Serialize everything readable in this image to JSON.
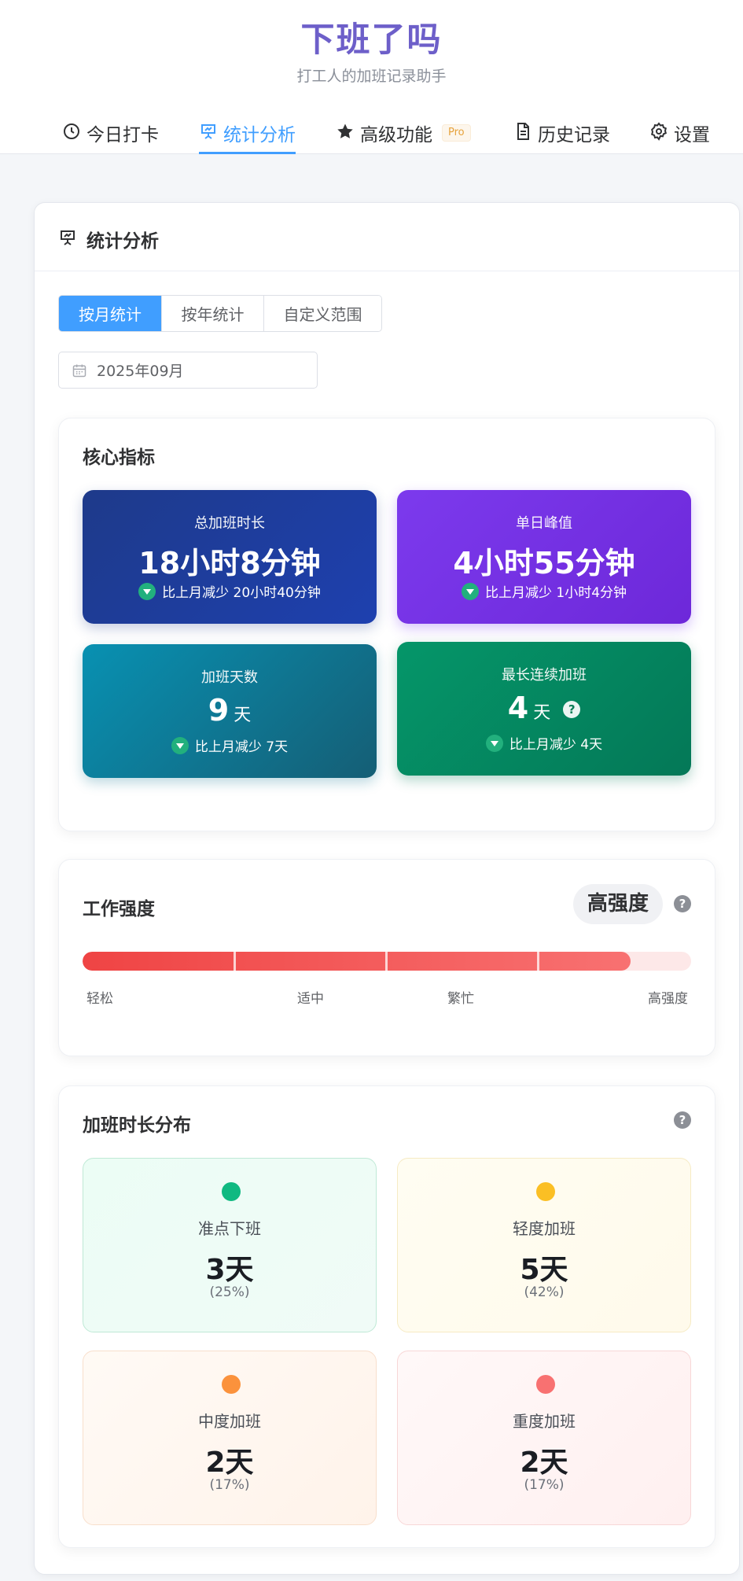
{
  "app": {
    "title": "下班了吗",
    "subtitle": "打工人的加班记录助手"
  },
  "nav": {
    "tabs": [
      {
        "label": "今日打卡",
        "icon": "clock-icon"
      },
      {
        "label": "统计分析",
        "icon": "presentation-chart-icon",
        "active": true
      },
      {
        "label": "高级功能",
        "icon": "star-icon",
        "badge": "Pro"
      },
      {
        "label": "历史记录",
        "icon": "document-icon"
      },
      {
        "label": "设置",
        "icon": "gear-icon"
      }
    ]
  },
  "stats": {
    "title": "统计分析",
    "modes": [
      "按月统计",
      "按年统计",
      "自定义范围"
    ],
    "active_mode": "按月统计",
    "date_value": "2025年09月"
  },
  "core": {
    "title": "核心指标",
    "metrics": [
      {
        "label": "总加班时长",
        "value": "18小时8分钟",
        "trend": "比上月减少 20小时40分钟",
        "color": "#1e3a8a"
      },
      {
        "label": "单日峰值",
        "value": "4小时55分钟",
        "trend": "比上月减少 1小时4分钟",
        "color": "#7c3aed"
      },
      {
        "label": "加班天数",
        "value": "9",
        "unit": "天",
        "trend": "比上月减少 7天",
        "color": "#0e7490"
      },
      {
        "label": "最长连续加班",
        "value": "4",
        "unit": "天",
        "trend": "比上月减少 4天",
        "color": "#047857"
      }
    ]
  },
  "intensity": {
    "title": "工作强度",
    "level": "高强度",
    "fill_fraction": 0.9,
    "scale_labels": [
      "轻松",
      "适中",
      "繁忙",
      "高强度"
    ],
    "color": "#ef4444"
  },
  "distribution": {
    "title": "加班时长分布",
    "items": [
      {
        "label": "准点下班",
        "value": "3天",
        "percent": "(25%)",
        "color": "#10b981"
      },
      {
        "label": "轻度加班",
        "value": "5天",
        "percent": "(42%)",
        "color": "#fbbf24"
      },
      {
        "label": "中度加班",
        "value": "2天",
        "percent": "(17%)",
        "color": "#fb923c"
      },
      {
        "label": "重度加班",
        "value": "2天",
        "percent": "(17%)",
        "color": "#f87171"
      }
    ]
  }
}
